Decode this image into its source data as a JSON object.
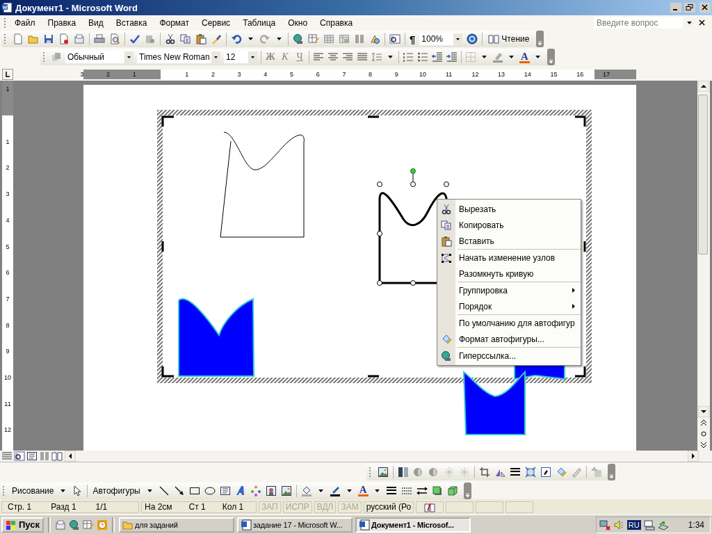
{
  "window": {
    "title": "Документ1 - Microsoft Word"
  },
  "menu": [
    "Файл",
    "Правка",
    "Вид",
    "Вставка",
    "Формат",
    "Сервис",
    "Таблица",
    "Окно",
    "Справка"
  ],
  "help_search": {
    "placeholder": "Введите вопрос"
  },
  "standard_toolbar": {
    "show_marks": "¶",
    "zoom": "100%",
    "reading": "Чтение"
  },
  "formatting_toolbar": {
    "style": "Обычный",
    "font": "Times New Roman",
    "size": "12",
    "bold": "Ж",
    "italic": "К",
    "underline": "Ч",
    "font_color": "A"
  },
  "ruler": {
    "left_numbers": [
      "3",
      "2",
      "1"
    ],
    "numbers": [
      "1",
      "2",
      "3",
      "4",
      "5",
      "6",
      "7",
      "8",
      "9",
      "10",
      "11",
      "12",
      "13",
      "14",
      "15",
      "16",
      "17"
    ]
  },
  "vertical_ruler": {
    "top_numbers": [
      "1"
    ],
    "numbers": [
      "1",
      "2",
      "3",
      "4",
      "5",
      "6",
      "7",
      "8",
      "9",
      "10",
      "11",
      "12"
    ]
  },
  "context_menu": {
    "groups": [
      [
        {
          "label": "Вырезать",
          "submenu": false
        },
        {
          "label": "Копировать",
          "submenu": false
        },
        {
          "label": "Вставить",
          "submenu": false
        }
      ],
      [
        {
          "label": "Начать изменение узлов",
          "submenu": false
        },
        {
          "label": "Разомкнуть кривую",
          "submenu": false
        }
      ],
      [
        {
          "label": "Группировка",
          "submenu": true
        },
        {
          "label": "Порядок",
          "submenu": true
        }
      ],
      [
        {
          "label": "По умолчанию для автофигур",
          "submenu": false
        },
        {
          "label": "Формат автофигуры...",
          "submenu": false
        }
      ],
      [
        {
          "label": "Гиперссылка...",
          "submenu": false
        }
      ]
    ]
  },
  "drawing_toolbar": {
    "drawing": "Рисование",
    "autoshapes": "Автофигуры",
    "font_color": "A"
  },
  "status_bar": {
    "page": "Стр. 1",
    "section": "Разд 1",
    "pages": "1/1",
    "at": "На 2см",
    "line": "Ст 1",
    "column": "Кол 1",
    "modes": [
      {
        "label": "ЗАП",
        "on": false
      },
      {
        "label": "ИСПР",
        "on": false
      },
      {
        "label": "ВДЛ",
        "on": false
      },
      {
        "label": "ЗАМ",
        "on": false
      }
    ],
    "language": "русский (Ро"
  },
  "taskbar": {
    "start": "Пуск",
    "tasks": [
      {
        "label": "для заданий",
        "selected": false
      },
      {
        "label": "задание 17 - Microsoft W...",
        "selected": false
      },
      {
        "label": "Документ1 - Microsof...",
        "selected": true
      }
    ],
    "language": "RU",
    "clock": "1:34"
  }
}
